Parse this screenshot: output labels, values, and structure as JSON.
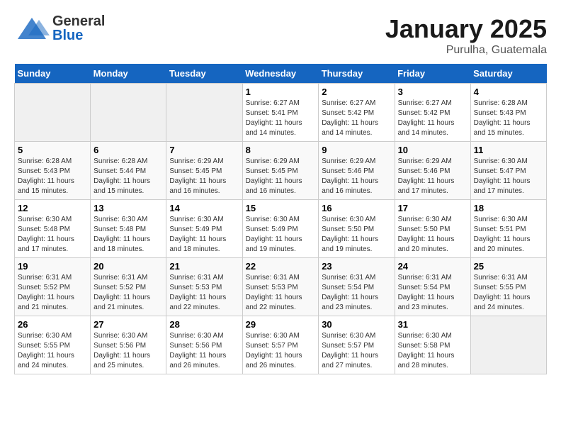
{
  "header": {
    "logo": {
      "general": "General",
      "blue": "Blue"
    },
    "title": "January 2025",
    "subtitle": "Purulha, Guatemala"
  },
  "weekdays": [
    "Sunday",
    "Monday",
    "Tuesday",
    "Wednesday",
    "Thursday",
    "Friday",
    "Saturday"
  ],
  "weeks": [
    [
      {
        "day": "",
        "sunrise": "",
        "sunset": "",
        "daylight": "",
        "empty": true
      },
      {
        "day": "",
        "sunrise": "",
        "sunset": "",
        "daylight": "",
        "empty": true
      },
      {
        "day": "",
        "sunrise": "",
        "sunset": "",
        "daylight": "",
        "empty": true
      },
      {
        "day": "1",
        "sunrise": "Sunrise: 6:27 AM",
        "sunset": "Sunset: 5:41 PM",
        "daylight": "Daylight: 11 hours and 14 minutes."
      },
      {
        "day": "2",
        "sunrise": "Sunrise: 6:27 AM",
        "sunset": "Sunset: 5:42 PM",
        "daylight": "Daylight: 11 hours and 14 minutes."
      },
      {
        "day": "3",
        "sunrise": "Sunrise: 6:27 AM",
        "sunset": "Sunset: 5:42 PM",
        "daylight": "Daylight: 11 hours and 14 minutes."
      },
      {
        "day": "4",
        "sunrise": "Sunrise: 6:28 AM",
        "sunset": "Sunset: 5:43 PM",
        "daylight": "Daylight: 11 hours and 15 minutes."
      }
    ],
    [
      {
        "day": "5",
        "sunrise": "Sunrise: 6:28 AM",
        "sunset": "Sunset: 5:43 PM",
        "daylight": "Daylight: 11 hours and 15 minutes."
      },
      {
        "day": "6",
        "sunrise": "Sunrise: 6:28 AM",
        "sunset": "Sunset: 5:44 PM",
        "daylight": "Daylight: 11 hours and 15 minutes."
      },
      {
        "day": "7",
        "sunrise": "Sunrise: 6:29 AM",
        "sunset": "Sunset: 5:45 PM",
        "daylight": "Daylight: 11 hours and 16 minutes."
      },
      {
        "day": "8",
        "sunrise": "Sunrise: 6:29 AM",
        "sunset": "Sunset: 5:45 PM",
        "daylight": "Daylight: 11 hours and 16 minutes."
      },
      {
        "day": "9",
        "sunrise": "Sunrise: 6:29 AM",
        "sunset": "Sunset: 5:46 PM",
        "daylight": "Daylight: 11 hours and 16 minutes."
      },
      {
        "day": "10",
        "sunrise": "Sunrise: 6:29 AM",
        "sunset": "Sunset: 5:46 PM",
        "daylight": "Daylight: 11 hours and 17 minutes."
      },
      {
        "day": "11",
        "sunrise": "Sunrise: 6:30 AM",
        "sunset": "Sunset: 5:47 PM",
        "daylight": "Daylight: 11 hours and 17 minutes."
      }
    ],
    [
      {
        "day": "12",
        "sunrise": "Sunrise: 6:30 AM",
        "sunset": "Sunset: 5:48 PM",
        "daylight": "Daylight: 11 hours and 17 minutes."
      },
      {
        "day": "13",
        "sunrise": "Sunrise: 6:30 AM",
        "sunset": "Sunset: 5:48 PM",
        "daylight": "Daylight: 11 hours and 18 minutes."
      },
      {
        "day": "14",
        "sunrise": "Sunrise: 6:30 AM",
        "sunset": "Sunset: 5:49 PM",
        "daylight": "Daylight: 11 hours and 18 minutes."
      },
      {
        "day": "15",
        "sunrise": "Sunrise: 6:30 AM",
        "sunset": "Sunset: 5:49 PM",
        "daylight": "Daylight: 11 hours and 19 minutes."
      },
      {
        "day": "16",
        "sunrise": "Sunrise: 6:30 AM",
        "sunset": "Sunset: 5:50 PM",
        "daylight": "Daylight: 11 hours and 19 minutes."
      },
      {
        "day": "17",
        "sunrise": "Sunrise: 6:30 AM",
        "sunset": "Sunset: 5:50 PM",
        "daylight": "Daylight: 11 hours and 20 minutes."
      },
      {
        "day": "18",
        "sunrise": "Sunrise: 6:30 AM",
        "sunset": "Sunset: 5:51 PM",
        "daylight": "Daylight: 11 hours and 20 minutes."
      }
    ],
    [
      {
        "day": "19",
        "sunrise": "Sunrise: 6:31 AM",
        "sunset": "Sunset: 5:52 PM",
        "daylight": "Daylight: 11 hours and 21 minutes."
      },
      {
        "day": "20",
        "sunrise": "Sunrise: 6:31 AM",
        "sunset": "Sunset: 5:52 PM",
        "daylight": "Daylight: 11 hours and 21 minutes."
      },
      {
        "day": "21",
        "sunrise": "Sunrise: 6:31 AM",
        "sunset": "Sunset: 5:53 PM",
        "daylight": "Daylight: 11 hours and 22 minutes."
      },
      {
        "day": "22",
        "sunrise": "Sunrise: 6:31 AM",
        "sunset": "Sunset: 5:53 PM",
        "daylight": "Daylight: 11 hours and 22 minutes."
      },
      {
        "day": "23",
        "sunrise": "Sunrise: 6:31 AM",
        "sunset": "Sunset: 5:54 PM",
        "daylight": "Daylight: 11 hours and 23 minutes."
      },
      {
        "day": "24",
        "sunrise": "Sunrise: 6:31 AM",
        "sunset": "Sunset: 5:54 PM",
        "daylight": "Daylight: 11 hours and 23 minutes."
      },
      {
        "day": "25",
        "sunrise": "Sunrise: 6:31 AM",
        "sunset": "Sunset: 5:55 PM",
        "daylight": "Daylight: 11 hours and 24 minutes."
      }
    ],
    [
      {
        "day": "26",
        "sunrise": "Sunrise: 6:30 AM",
        "sunset": "Sunset: 5:55 PM",
        "daylight": "Daylight: 11 hours and 24 minutes."
      },
      {
        "day": "27",
        "sunrise": "Sunrise: 6:30 AM",
        "sunset": "Sunset: 5:56 PM",
        "daylight": "Daylight: 11 hours and 25 minutes."
      },
      {
        "day": "28",
        "sunrise": "Sunrise: 6:30 AM",
        "sunset": "Sunset: 5:56 PM",
        "daylight": "Daylight: 11 hours and 26 minutes."
      },
      {
        "day": "29",
        "sunrise": "Sunrise: 6:30 AM",
        "sunset": "Sunset: 5:57 PM",
        "daylight": "Daylight: 11 hours and 26 minutes."
      },
      {
        "day": "30",
        "sunrise": "Sunrise: 6:30 AM",
        "sunset": "Sunset: 5:57 PM",
        "daylight": "Daylight: 11 hours and 27 minutes."
      },
      {
        "day": "31",
        "sunrise": "Sunrise: 6:30 AM",
        "sunset": "Sunset: 5:58 PM",
        "daylight": "Daylight: 11 hours and 28 minutes."
      },
      {
        "day": "",
        "sunrise": "",
        "sunset": "",
        "daylight": "",
        "empty": true
      }
    ]
  ]
}
